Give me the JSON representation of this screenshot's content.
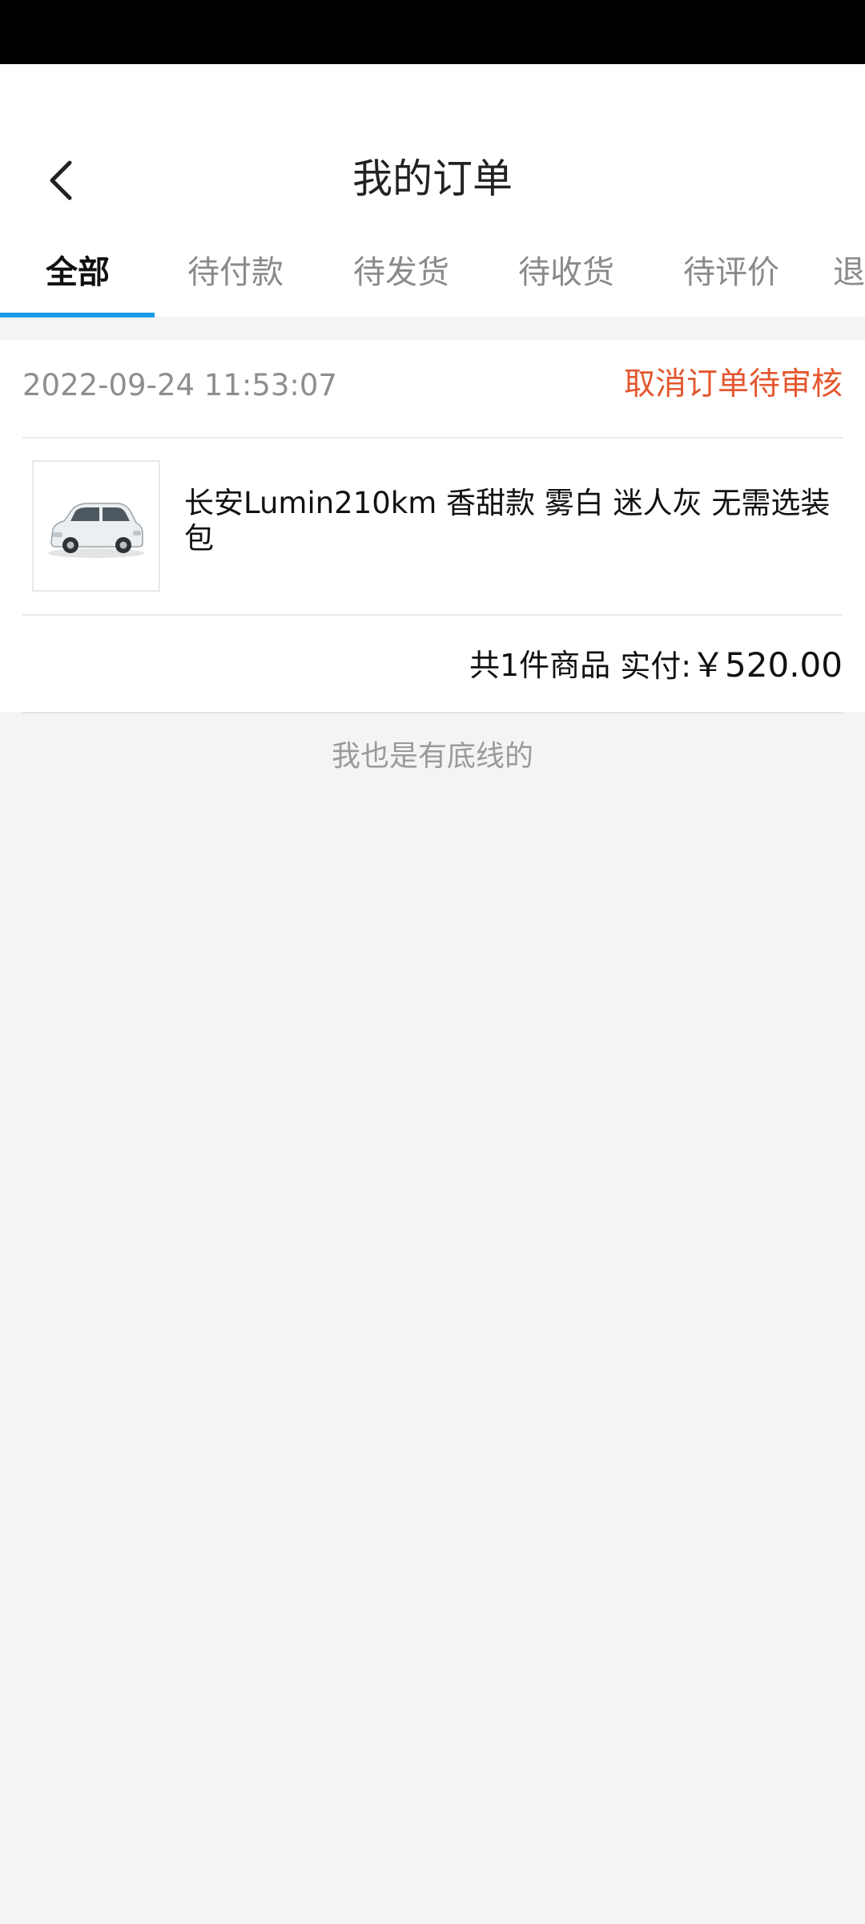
{
  "header": {
    "title": "我的订单",
    "back_icon": "chevron-left-icon"
  },
  "tabs": [
    {
      "label": "全部",
      "active": true
    },
    {
      "label": "待付款"
    },
    {
      "label": "待发货"
    },
    {
      "label": "待收货"
    },
    {
      "label": "待评价"
    },
    {
      "label": "退"
    }
  ],
  "order": {
    "time": "2022-09-24 11:53:07",
    "status": "取消订单待审核",
    "product_name": "长安Lumin210km 香甜款 雾白 迷人灰 无需选装包",
    "product_image": "car-thumbnail",
    "count_text": "共1件商品",
    "paid_label": "实付:",
    "paid_amount": "￥520.00"
  },
  "footer": {
    "note": "我也是有底线的"
  },
  "colors": {
    "accent_tab": "#1e9be6",
    "status_red": "#e4572f"
  }
}
